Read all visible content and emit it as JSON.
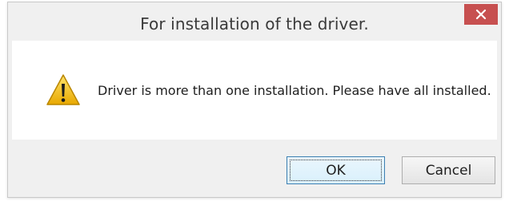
{
  "dialog": {
    "title": "For installation of the driver.",
    "message": "Driver is more than one installation. Please have all installed.",
    "icon": "warning-icon",
    "buttons": {
      "ok_label": "OK",
      "cancel_label": "Cancel"
    },
    "close_icon": "close-icon"
  },
  "colors": {
    "close_button": "#c75050",
    "warning_fill": "#f5c400",
    "ok_border": "#3c7fb1"
  }
}
